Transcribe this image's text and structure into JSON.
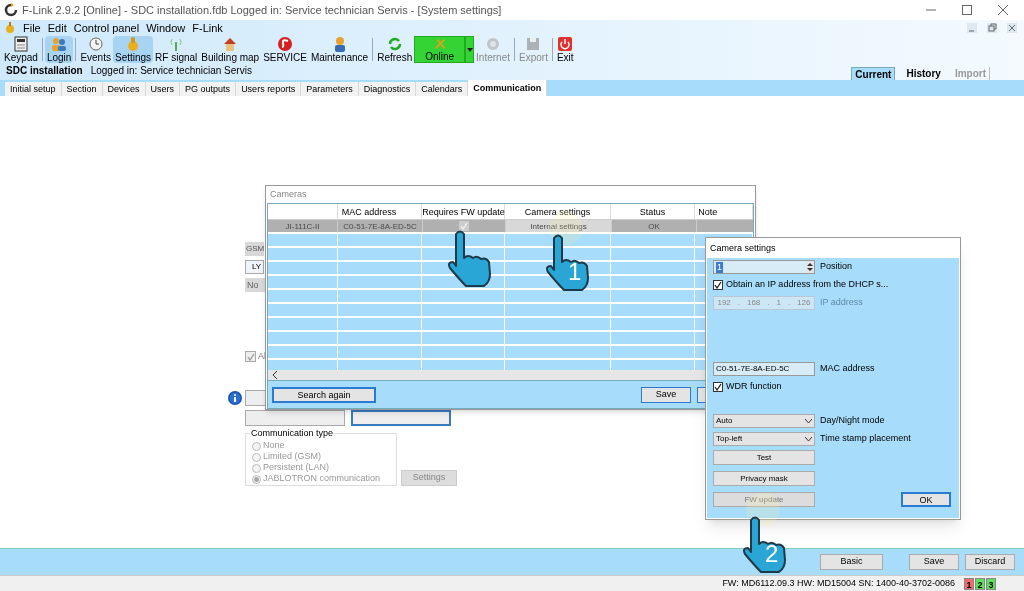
{
  "window": {
    "title": "F-Link 2.9.2 [Online] - SDC installation.fdb Logged in: Service technician Servis - [System settings]"
  },
  "menu": [
    "File",
    "Edit",
    "Control panel",
    "Window",
    "F-Link"
  ],
  "toolbar": [
    [
      {
        "label": "Keypad",
        "kind": "keypad",
        "selected": false,
        "disabled": false
      }
    ],
    [
      {
        "label": "Login",
        "kind": "login",
        "selected": true,
        "disabled": false
      }
    ],
    [
      {
        "label": "Events",
        "kind": "events",
        "selected": false,
        "disabled": false
      },
      {
        "label": "Settings",
        "kind": "settings",
        "selected": true,
        "disabled": false
      },
      {
        "label": "RF signal",
        "kind": "rf",
        "selected": false,
        "disabled": false
      },
      {
        "label": "Building map",
        "kind": "building",
        "selected": false,
        "disabled": false
      },
      {
        "label": "SERVICE",
        "kind": "service",
        "selected": false,
        "disabled": false
      },
      {
        "label": "Maintenance",
        "kind": "maintenance",
        "selected": false,
        "disabled": false
      }
    ],
    [
      {
        "label": "Refresh",
        "kind": "refresh",
        "selected": false,
        "disabled": false
      },
      {
        "label": "Online",
        "kind": "online",
        "selected": false,
        "disabled": false
      },
      {
        "label": "Internet",
        "kind": "internet",
        "selected": false,
        "disabled": true
      }
    ],
    [
      {
        "label": "Export",
        "kind": "export",
        "selected": false,
        "disabled": true
      }
    ],
    [
      {
        "label": "Exit",
        "kind": "exit",
        "selected": false,
        "disabled": false
      }
    ]
  ],
  "session": {
    "installation": "SDC installation",
    "user": "Logged in: Service technician Servis"
  },
  "view_tabs": [
    {
      "label": "Current",
      "selected": true,
      "disabled": false
    },
    {
      "label": "History",
      "selected": false,
      "disabled": false
    },
    {
      "label": "Import",
      "selected": false,
      "disabled": true
    }
  ],
  "tabs": [
    {
      "label": "Initial setup",
      "selected": false
    },
    {
      "label": "Section",
      "selected": false
    },
    {
      "label": "Devices",
      "selected": false
    },
    {
      "label": "Users",
      "selected": false
    },
    {
      "label": "PG outputs",
      "selected": false
    },
    {
      "label": "Users reports",
      "selected": false
    },
    {
      "label": "Parameters",
      "selected": false
    },
    {
      "label": "Diagnostics",
      "selected": false
    },
    {
      "label": "Calendars",
      "selected": false
    },
    {
      "label": "Communication",
      "selected": true
    }
  ],
  "background": {
    "gsm_label": "GSM",
    "ly_button": "LY",
    "no_field": "No",
    "all_checkbox": {
      "label": "Al",
      "checked": true
    },
    "communication_type": {
      "title": "Communication type",
      "options": [
        {
          "label": "None",
          "selected": false
        },
        {
          "label": "Limited (GSM)",
          "selected": false
        },
        {
          "label": "Persistent (LAN)",
          "selected": false
        },
        {
          "label": "JABLOTRON communication",
          "selected": true
        }
      ]
    },
    "settings_button": "Settings"
  },
  "cameras_dialog": {
    "title": "Cameras",
    "columns": [
      "MAC address",
      "Requires FW update",
      "Camera settings",
      "Status",
      "Note"
    ],
    "rows": [
      {
        "name": "JI-111C-II",
        "mac": "C0-51-7E-8A-ED-5C",
        "requires_fw_update": true,
        "camera_settings": "Internal settings",
        "status": "OK",
        "selected": true
      }
    ],
    "search_button": "Search again",
    "save_button": "Save"
  },
  "camera_settings": {
    "title": "Camera settings",
    "position": {
      "value": "1",
      "label": "Position"
    },
    "dhcp": {
      "label": "Obtain an IP address from the DHCP s...",
      "checked": true
    },
    "ip": {
      "octets": [
        "192",
        "168",
        "1",
        "126"
      ],
      "separator": ".",
      "label": "IP address",
      "disabled": true
    },
    "mac": {
      "value": "C0-51-7E-8A-ED-5C",
      "label": "MAC address"
    },
    "wdr": {
      "label": "WDR function",
      "checked": true
    },
    "day_night": {
      "value": "Auto",
      "label": "Day/Night mode"
    },
    "timestamp": {
      "value": "Top-left",
      "label": "Time stamp placement"
    },
    "buttons": [
      {
        "label": "Test",
        "disabled": false
      },
      {
        "label": "Privacy mask",
        "disabled": false
      },
      {
        "label": "FW update",
        "disabled": true
      }
    ],
    "ok_button": "OK"
  },
  "annotations": [
    {
      "kind": "plain"
    },
    {
      "kind": "numbered",
      "label": "1"
    },
    {
      "kind": "numbered",
      "label": "2"
    }
  ],
  "footer_buttons": [
    "Basic",
    "Save",
    "Discard"
  ],
  "status_bar": {
    "text": "FW: MD6112.09.3 HW: MD15004 SN: 1400-40-3702-0086",
    "indicators": [
      {
        "label": "1",
        "color": "#f46a6a"
      },
      {
        "label": "2",
        "color": "#5ee05e"
      },
      {
        "label": "3",
        "color": "#5ee05e"
      }
    ]
  }
}
